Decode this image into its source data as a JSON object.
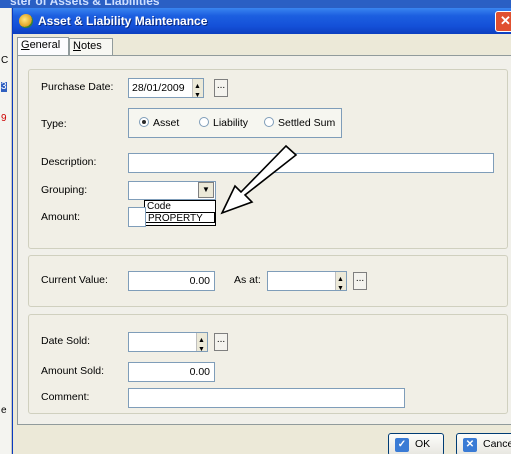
{
  "background_app": {
    "title": "ster of Assets & Liabilities",
    "strip_glyphs": [
      "C",
      "3",
      "9",
      "e"
    ]
  },
  "dialog": {
    "title": "Asset & Liability Maintenance",
    "close_glyph": "✕",
    "tabs": [
      {
        "label_first": "G",
        "label_rest": "eneral",
        "active": true
      },
      {
        "label_first": "N",
        "label_rest": "otes",
        "active": false
      }
    ]
  },
  "asset_section": {
    "purchase_date_label": "Purchase Date:",
    "purchase_date_value": "28/01/2009",
    "type_label": "Type:",
    "type_options": [
      {
        "label": "Asset",
        "selected": true
      },
      {
        "label": "Liability",
        "selected": false
      },
      {
        "label": "Settled Sum",
        "selected": false
      }
    ],
    "description_label": "Description:",
    "description_value": "",
    "grouping_label": "Grouping:",
    "grouping_value": "",
    "grouping_options": [
      "Code",
      "PROPERTY"
    ],
    "amount_label": "Amount:"
  },
  "value_section": {
    "current_value_label": "Current Value:",
    "current_value": "0.00",
    "as_at_label": "As at:",
    "as_at_value": ""
  },
  "sale_section": {
    "date_sold_label": "Date Sold:",
    "date_sold_value": "",
    "amount_sold_label": "Amount Sold:",
    "amount_sold_value": "0.00",
    "comment_label": "Comment:",
    "comment_value": ""
  },
  "buttons": {
    "ok": "OK",
    "cancel": "Cancel"
  },
  "colors": {
    "titlebar": "#1c5fe0",
    "dialog_bg": "#ece9d8",
    "close": "#e05030"
  }
}
